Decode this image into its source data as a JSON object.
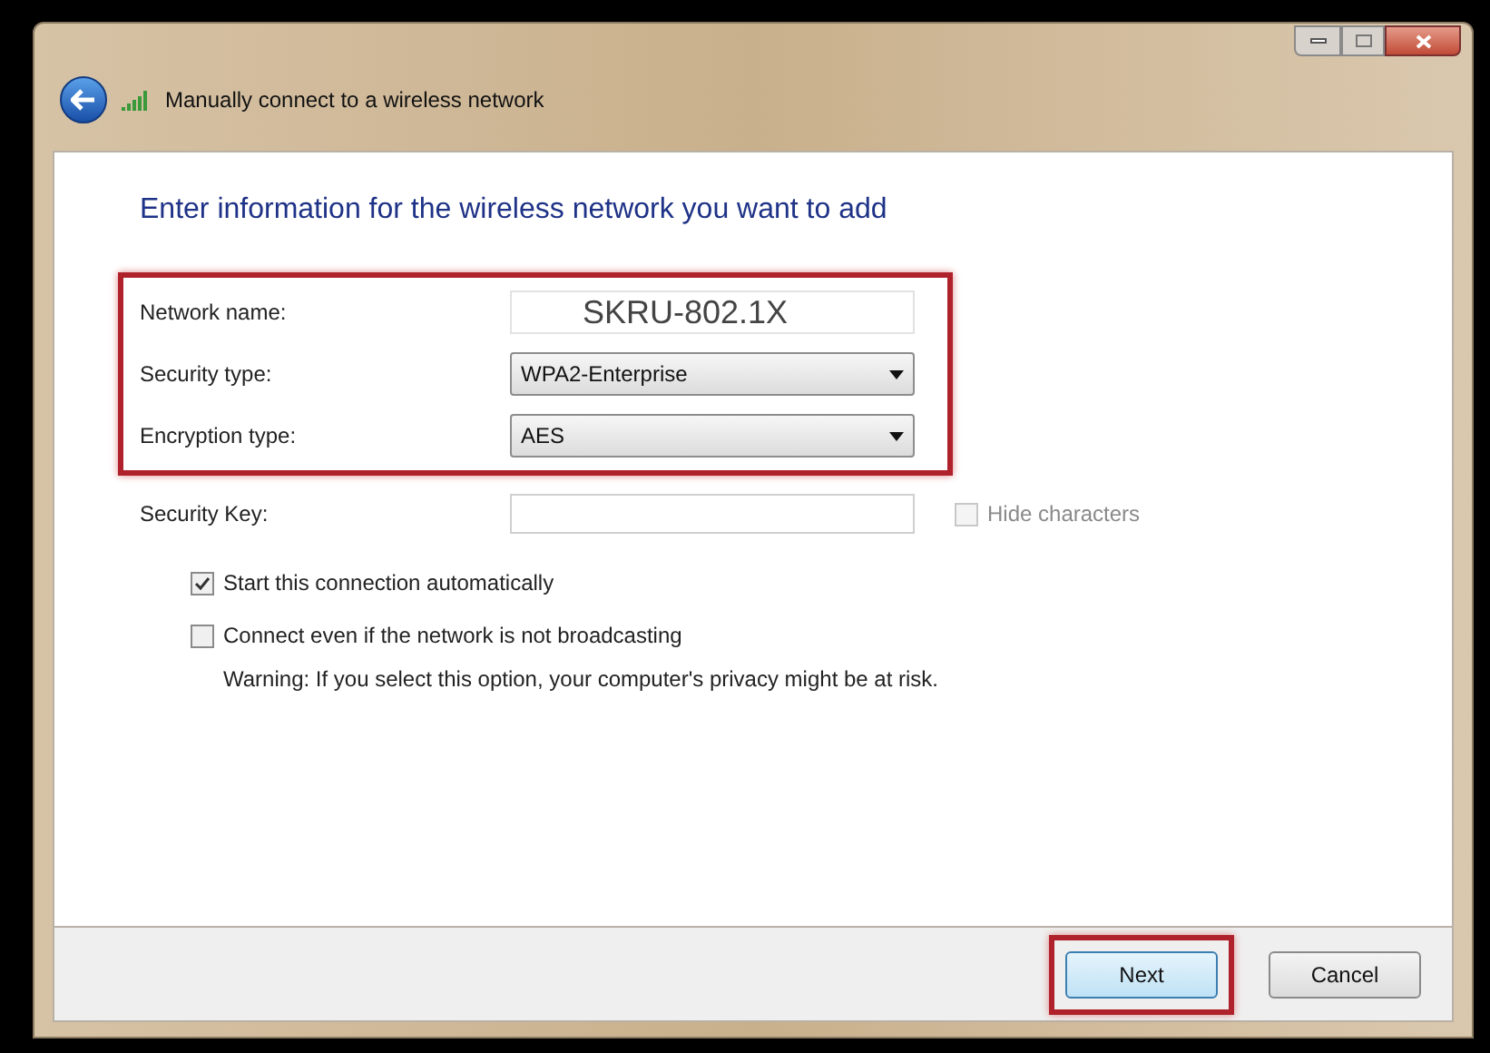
{
  "window": {
    "title": "Manually connect to a wireless network"
  },
  "heading": "Enter information for the wireless network you want to add",
  "highlighted_fields": [
    {
      "kind": "text",
      "label": "Network name:",
      "value": "SKRU-802.1X"
    },
    {
      "kind": "dropdown",
      "label": "Security type:",
      "value": "WPA2-Enterprise"
    },
    {
      "kind": "dropdown",
      "label": "Encryption type:",
      "value": "AES"
    }
  ],
  "other_fields": [
    {
      "kind": "key",
      "label": "Security Key:",
      "option": {
        "label": "Hide characters",
        "checked": false,
        "disabled": true
      }
    }
  ],
  "options": [
    {
      "label": "Start this connection automatically",
      "checked": true
    },
    {
      "label": "Connect even if the network is not broadcasting",
      "checked": false,
      "note": "Warning: If you select this option, your computer's privacy might be at risk."
    }
  ],
  "buttons": [
    {
      "label": "Next",
      "highlighted": true,
      "default": true
    },
    {
      "label": "Cancel",
      "highlighted": false,
      "default": false
    }
  ]
}
